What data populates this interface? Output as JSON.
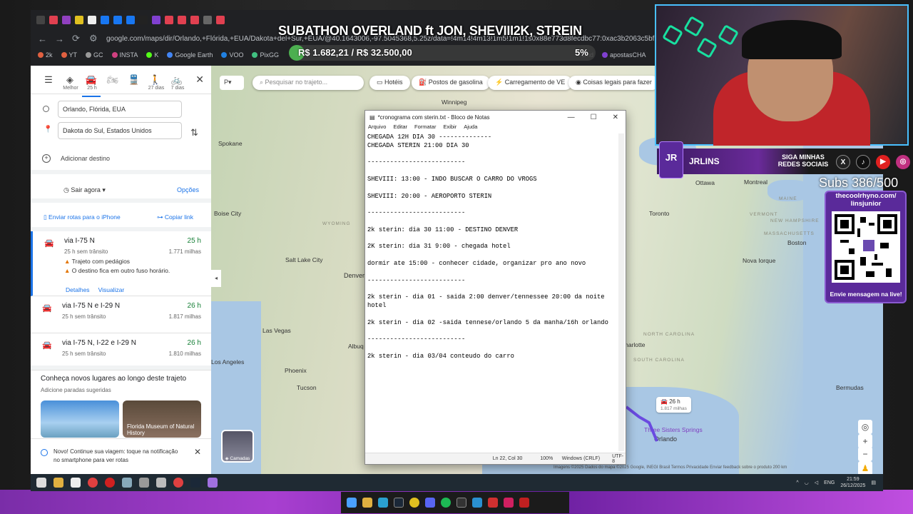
{
  "overlay": {
    "title": "SUBATHON OVERLAND ft JON, SHEVIII2K, STREIN",
    "money": "R$ 1.682,21 / R$ 32.500,00",
    "percent": "5%",
    "progress_fraction": 0.05,
    "brand_logo": "JR",
    "brand_name": "JRLINS",
    "follow": "SIGA MINHAS REDES SOCIAIS",
    "subs": "Subs 386/500",
    "qr_url": "thecoolrhyno.com/ linsjunior",
    "qr_msg": "Envie mensagem na live!",
    "social_icons": [
      "x-icon",
      "tiktok-icon",
      "youtube-icon",
      "instagram-icon"
    ]
  },
  "browser": {
    "url": "google.com/maps/dir/Orlando,+Flórida,+EUA/Dakota+del+Sur,+EUA/@40.1643006,-97.5045368,5.25z/data=!4m14!4m13!1m5!1m1!1s0x88e773d8fecdbc77:0xac3b2063c5bf9e12m2!1d-81.3789269!2d28",
    "bookmarks": [
      "2k",
      "YT",
      "GC",
      "INSTA",
      "K",
      "Google Earth",
      "VOO",
      "PixGG",
      "cmd",
      "apostasCHA"
    ]
  },
  "directions": {
    "modes": [
      {
        "icon": "best-route-icon",
        "label": "Melhor"
      },
      {
        "icon": "car-icon",
        "label": "25 h"
      },
      {
        "icon": "motorcycle-icon",
        "label": ""
      },
      {
        "icon": "transit-icon",
        "label": ""
      },
      {
        "icon": "walk-icon",
        "label": "27 dias"
      },
      {
        "icon": "bike-icon",
        "label": "7 dias"
      }
    ],
    "origin": "Orlando, Flórida, EUA",
    "destination": "Dakota do Sul, Estados Unidos",
    "add_destination": "Adicionar destino",
    "leave_now": "Sair agora",
    "options": "Opções",
    "send_to_phone": "Enviar rotas para o iPhone",
    "copy_link": "Copiar link",
    "routes": [
      {
        "name": "via I-75 N",
        "time": "25 h",
        "sub": "25 h sem trânsito",
        "distance": "1.771 milhas",
        "warnings": [
          "Trajeto com pedágios",
          "O destino fica em outro fuso horário."
        ],
        "details": "Detalhes",
        "preview": "Visualizar"
      },
      {
        "name": "via I-75 N e I-29 N",
        "time": "26 h",
        "sub": "25 h sem trânsito",
        "distance": "1.817 milhas"
      },
      {
        "name": "via I-75 N, I-22 e I-29 N",
        "time": "26 h",
        "sub": "25 h sem trânsito",
        "distance": "1.810 milhas"
      }
    ],
    "discover_title": "Conheça novos lugares ao longo deste trajeto",
    "discover_sub": "Adicione paradas sugeridas",
    "thumb2_caption": "Florida Museum of Natural History",
    "notice": "Novo! Continue sua viagem: toque na notificação no smartphone para ver rotas"
  },
  "map": {
    "search_placeholder": "Pesquisar no trajeto...",
    "chips": [
      "Hotéis",
      "Postos de gasolina",
      "Carregamento de VE",
      "Coisas legais para fazer"
    ],
    "cities": [
      {
        "name": "Winnipeg"
      },
      {
        "name": "Spokane"
      },
      {
        "name": "Boise City"
      },
      {
        "name": "Salt Lake City"
      },
      {
        "name": "Denver"
      },
      {
        "name": "Las Vegas"
      },
      {
        "name": "Los Angeles"
      },
      {
        "name": "Phoenix"
      },
      {
        "name": "Tucson"
      },
      {
        "name": "Albuq"
      },
      {
        "name": "Ottawa"
      },
      {
        "name": "Montreal"
      },
      {
        "name": "Toronto"
      },
      {
        "name": "Boston"
      },
      {
        "name": "Nova Iorque"
      },
      {
        "name": "Charlotte"
      },
      {
        "name": "Bermudas"
      },
      {
        "name": "Orlando"
      },
      {
        "name": "Three Sisters Springs"
      }
    ],
    "states": [
      "WYOMING",
      "MAINE",
      "VERMONT",
      "NEW HAMPSHIRE",
      "MASSACHUSETTS",
      "NORTH CAROLINA",
      "SOUTH CAROLINA"
    ],
    "layers_label": "Camadas",
    "route_badge": "26 h",
    "route_badge_sub": "1.817 milhas",
    "footer": "Imagens ©2025 Dados do mapa ©2025 Google, INEGI   Brasil   Termos   Privacidade   Enviar feedback sobre o produto   200 km"
  },
  "notepad": {
    "title": "*cronograma com sterin.txt - Bloco de Notas",
    "menu": [
      "Arquivo",
      "Editar",
      "Formatar",
      "Exibir",
      "Ajuda"
    ],
    "content": "CHEGADA 12H DIA 30 --------------\nCHEGADA STERIN 21:00 DIA 30\n\n--------------------------\n\nSHEVIII: 13:00 - INDO BUSCAR O CARRO DO VROGS\n\nSHEVIII: 20:00 - AEROPORTO STERIN\n\n--------------------------\n\n2k sterin: dia 30 11:00 - DESTINO DENVER\n\n2K sterin: dia 31 9:00 - chegada hotel\n\ndormir ate 15:00 - conhecer cidade, organizar pro ano novo\n\n--------------------------\n\n2k sterin - dia 01 - saida 2:00 denver/tennessee 20:00 da noite  hotel\n\n2k sterin - dia 02 -saida tennese/orlando 5 da manha/16h orlando\n\n--------------------------\n\n2k sterin - dia 03/04 conteudo do carro",
    "status_pos": "Ln 22, Col 30",
    "status_zoom": "100%",
    "status_eol": "Windows (CRLF)",
    "status_enc": "UTF-8"
  },
  "taskbar": {
    "lang": "ENG",
    "time": "21:59",
    "date": "26/12/2025"
  }
}
